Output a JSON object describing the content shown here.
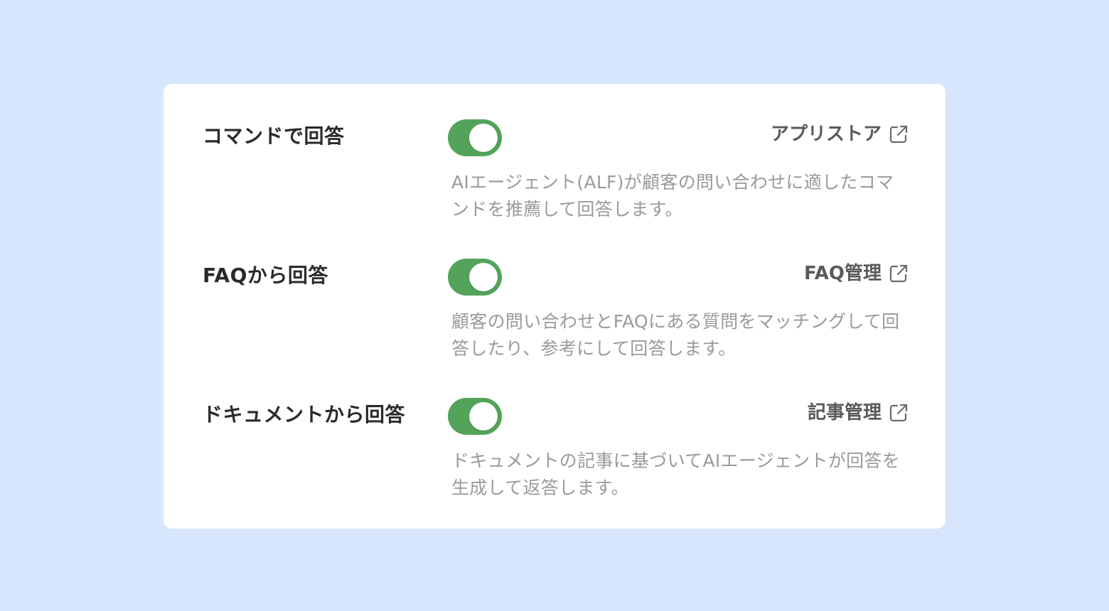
{
  "colors": {
    "page_background": "#d8e6fd",
    "card_background": "#ffffff",
    "toggle_on": "#53a45a",
    "label_text": "#2a2a2a",
    "link_text": "#5a5a5a",
    "description_text": "#9a9a9a"
  },
  "settings": [
    {
      "label": "コマンドで回答",
      "enabled": true,
      "link_label": "アプリストア",
      "link_icon": "external-link-icon",
      "description": "AIエージェント(ALF)が顧客の問い合わせに適したコマンドを推薦して回答します。"
    },
    {
      "label": "FAQから回答",
      "enabled": true,
      "link_label": "FAQ管理",
      "link_icon": "external-link-icon",
      "description": "顧客の問い合わせとFAQにある質問をマッチングして回答したり、参考にして回答します。"
    },
    {
      "label": "ドキュメントから回答",
      "enabled": true,
      "link_label": "記事管理",
      "link_icon": "external-link-icon",
      "description": "ドキュメントの記事に基づいてAIエージェントが回答を生成して返答します。"
    }
  ]
}
